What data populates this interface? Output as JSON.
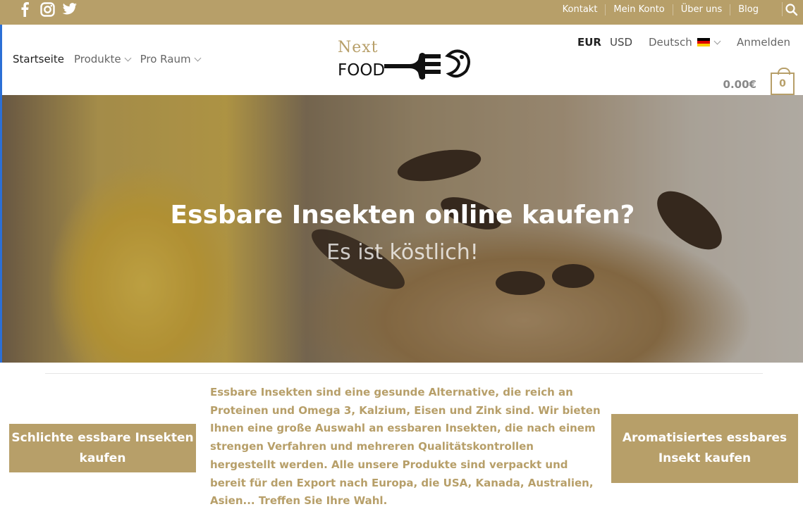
{
  "colors": {
    "brand": "#b79f69",
    "topbar_text": "#ffffff",
    "nav_active": "#222222"
  },
  "topbar": {
    "social": [
      {
        "icon": "facebook-icon"
      },
      {
        "icon": "instagram-icon"
      },
      {
        "icon": "twitter-icon"
      }
    ],
    "links": [
      "Kontakt",
      "Mein Konto",
      "Über uns",
      "Blog"
    ],
    "search_icon": "search-icon"
  },
  "nav": {
    "items": [
      {
        "label": "Startseite",
        "active": true,
        "dropdown": false
      },
      {
        "label": "Produkte",
        "active": false,
        "dropdown": true
      },
      {
        "label": "Pro Raum",
        "active": false,
        "dropdown": true
      }
    ]
  },
  "logo": {
    "line1": "Next",
    "line2": "FOOD"
  },
  "header_right": {
    "currency_selected": "EUR",
    "currency_other": "USD",
    "language": "Deutsch",
    "login": "Anmelden",
    "cart_total": "0.00€",
    "cart_count": "0"
  },
  "hero": {
    "title": "Essbare Insekten online kaufen?",
    "subtitle": "Es ist köstlich!"
  },
  "content": {
    "left_button": "Schlichte essbare Insekten kaufen",
    "description": "Essbare Insekten sind eine gesunde Alternative, die reich an Proteinen und Omega 3, Kalzium, Eisen und Zink sind. Wir bieten Ihnen eine große Auswahl an essbaren Insekten, die nach einem strengen Verfahren und mehreren Qualitätskontrollen hergestellt werden. Alle unsere Produkte sind verpackt und bereit für den Export nach Europa, die USA, Kanada, Australien, Asien... Treffen Sie Ihre Wahl.",
    "right_button": "Aromatisiertes essbares Insekt kaufen"
  }
}
